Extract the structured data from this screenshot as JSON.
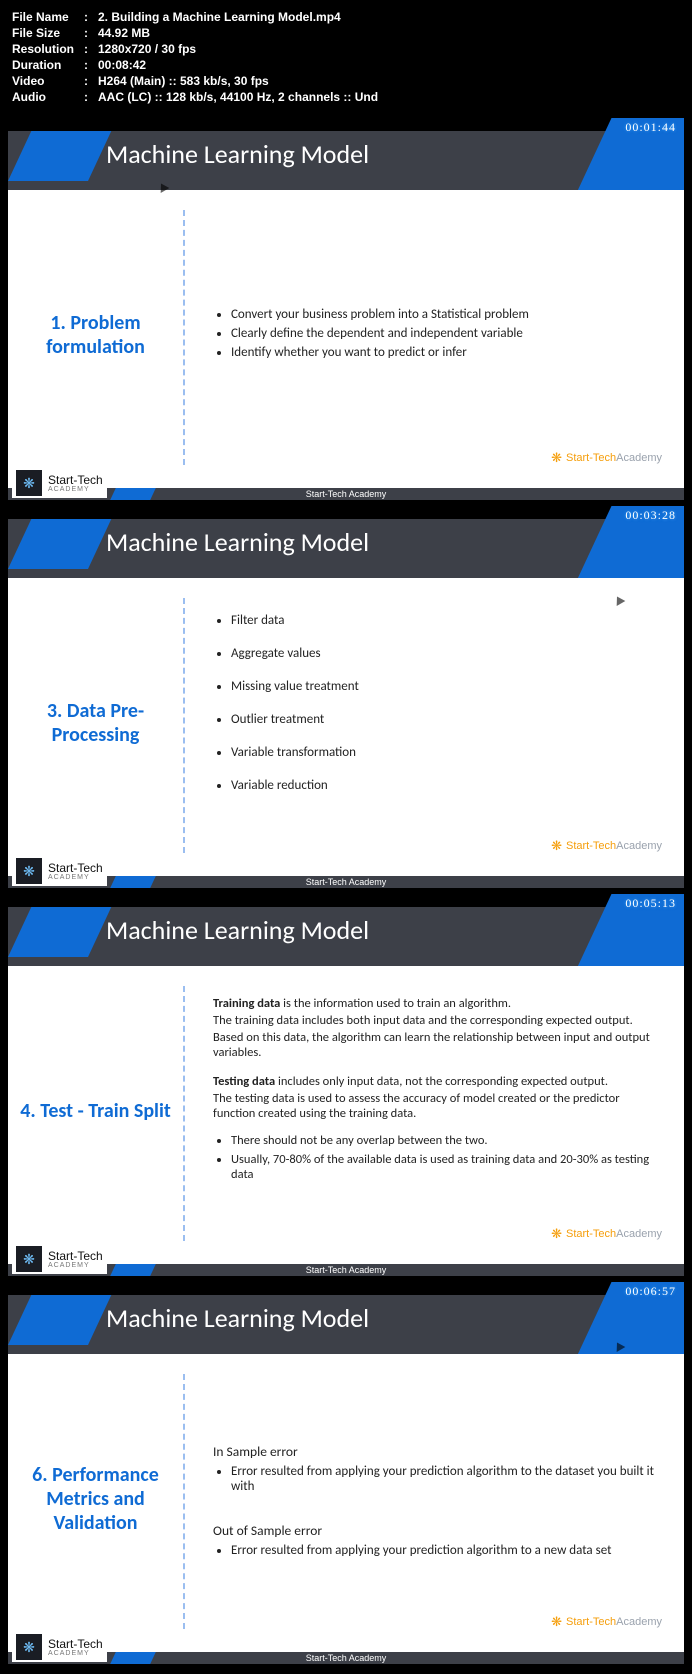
{
  "meta": {
    "fileNameLabel": "File Name",
    "fileName": "2. Building a Machine Learning Model.mp4",
    "fileSizeLabel": "File Size",
    "fileSize": "44.92 MB",
    "resolutionLabel": "Resolution",
    "resolution": "1280x720 / 30 fps",
    "durationLabel": "Duration",
    "duration": "00:08:42",
    "videoLabel": "Video",
    "video": "H264 (Main) :: 583 kb/s, 30 fps",
    "audioLabel": "Audio",
    "audio": "AAC (LC) :: 128 kb/s, 44100 Hz, 2 channels :: Und"
  },
  "common": {
    "headerTitle": "Machine Learning Model",
    "footerCenter": "Start-Tech Academy",
    "logoL1": "Start-Tech",
    "logoL2": "ACADEMY",
    "watermarkA": "Start-Tech",
    "watermarkB": "Academy"
  },
  "slides": [
    {
      "timestamp": "00:01:44",
      "leftTitle": "1. Problem formulation",
      "bullets": [
        "Convert your business problem into a Statistical problem",
        "Clearly define the dependent and independent variable",
        "Identify whether you want to predict or infer"
      ]
    },
    {
      "timestamp": "00:03:28",
      "leftTitle": "3. Data Pre-Processing",
      "bullets": [
        "Filter data",
        "Aggregate values",
        "Missing value treatment",
        "Outlier treatment",
        "Variable transformation",
        "Variable reduction"
      ]
    },
    {
      "timestamp": "00:05:13",
      "leftTitle": "4. Test - Train Split",
      "p1a": "Training data",
      "p1b": " is the information used to train an algorithm.",
      "p2": "The training data includes both input data and the corresponding expected output.",
      "p3": "Based on this data, the algorithm can learn the relationship between input and output variables.",
      "p4a": "Testing data",
      "p4b": " includes only input data, not the corresponding expected output.",
      "p5": "The testing data is used to assess the accuracy of model created or the predictor function created using the training data.",
      "b1": "There should not be any overlap between the two.",
      "b2": "Usually, 70-80% of the available data is used as training data and 20-30% as testing data"
    },
    {
      "timestamp": "00:06:57",
      "leftTitle": "6. Performance Metrics and Validation",
      "h1": "In Sample error",
      "h1b": "Error resulted from applying your prediction algorithm to the dataset you built it with",
      "h2": "Out of Sample error",
      "h2b": "Error resulted from applying your prediction algorithm to a new data set"
    }
  ]
}
